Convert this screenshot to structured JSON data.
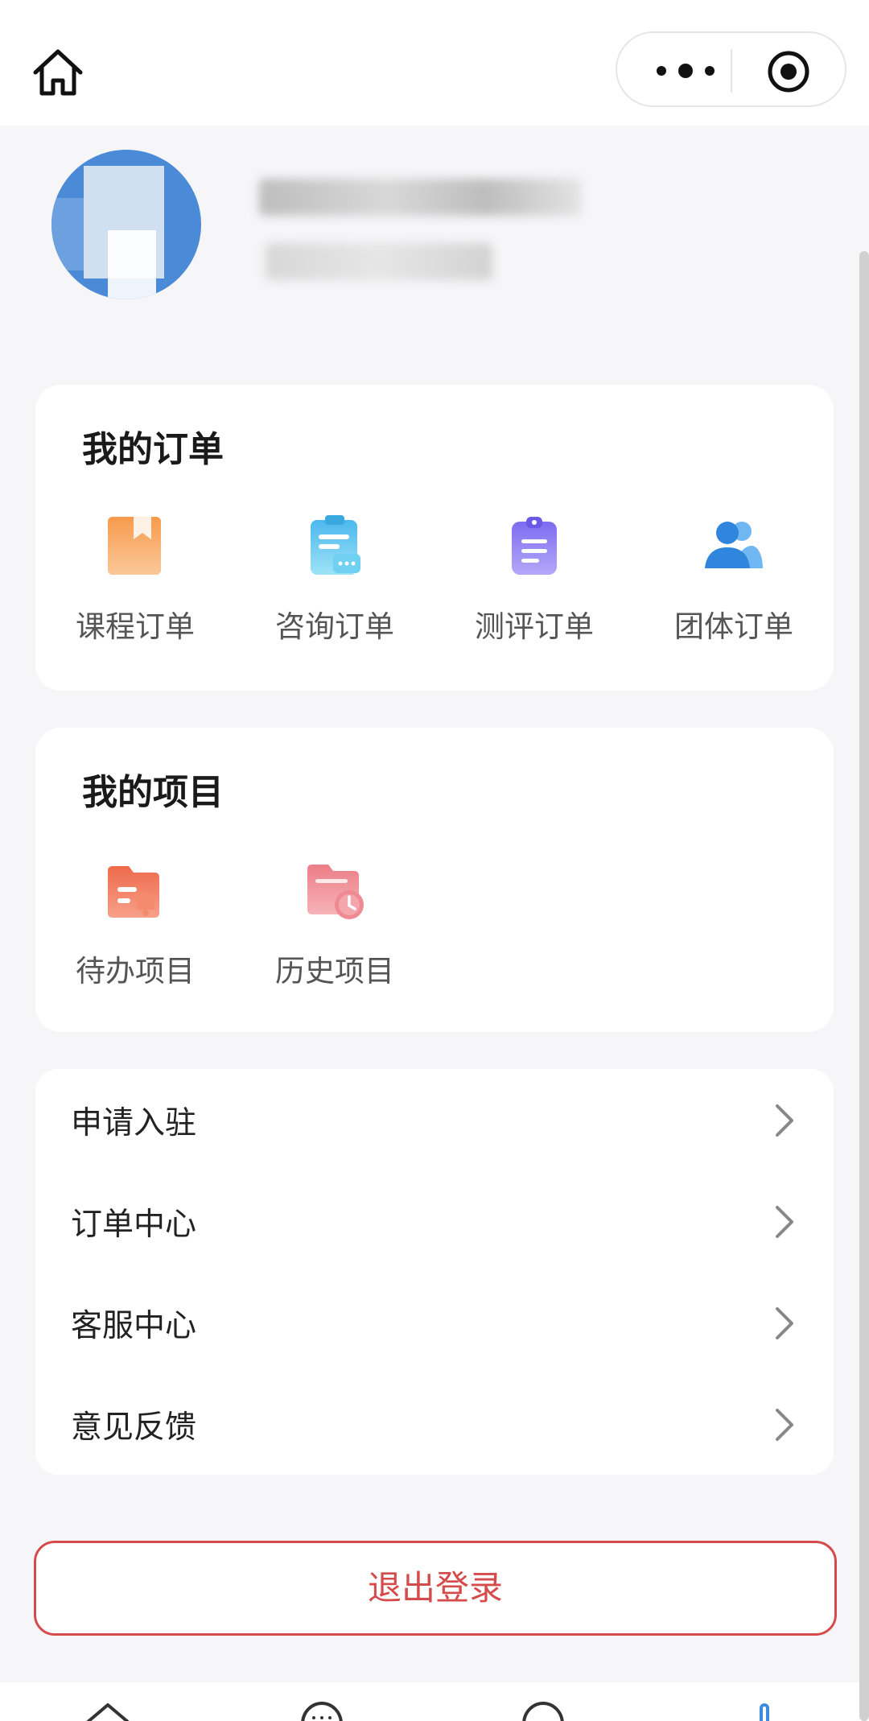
{
  "nav": {
    "home_icon": "home-icon",
    "more_icon": "more-dots-icon",
    "close_icon": "target-circle-icon"
  },
  "orders": {
    "title": "我的订单",
    "items": [
      {
        "label": "课程订单",
        "icon": "course-book-icon",
        "color": "#f6a05a"
      },
      {
        "label": "咨询订单",
        "icon": "consult-clipboard-icon",
        "color": "#57c4ee"
      },
      {
        "label": "测评订单",
        "icon": "assessment-clipboard-icon",
        "color": "#8f7cf0"
      },
      {
        "label": "团体订单",
        "icon": "group-people-icon",
        "color": "#3a8ce0"
      }
    ]
  },
  "projects": {
    "title": "我的项目",
    "items": [
      {
        "label": "待办项目",
        "icon": "todo-folder-bell-icon",
        "color": "#f07a5a"
      },
      {
        "label": "历史项目",
        "icon": "history-folder-clock-icon",
        "color": "#ee8a90"
      }
    ]
  },
  "menu": [
    {
      "label": "申请入驻"
    },
    {
      "label": "订单中心"
    },
    {
      "label": "客服中心"
    },
    {
      "label": "意见反馈"
    }
  ],
  "logout_label": "退出登录",
  "colors": {
    "danger": "#d54a4a",
    "background": "#f6f6f8"
  }
}
